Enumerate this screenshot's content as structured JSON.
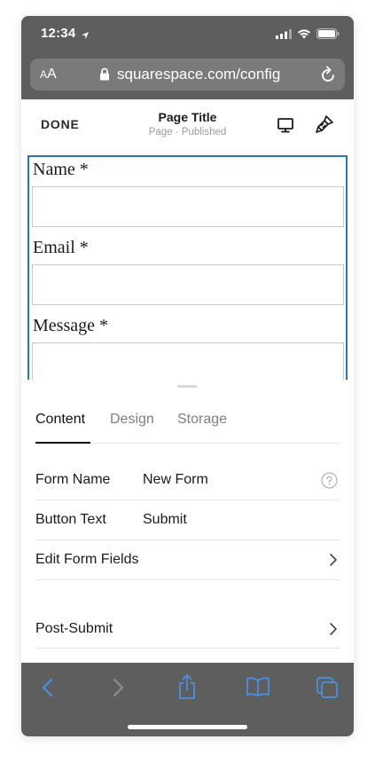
{
  "status_bar": {
    "time": "12:34"
  },
  "url_bar": {
    "aa_small": "A",
    "aa_large": "A",
    "url": "squarespace.com/config"
  },
  "editor_header": {
    "done_label": "DONE",
    "page_title": "Page Title",
    "page_subtitle": "Page · Published"
  },
  "form_preview": {
    "fields": [
      {
        "label": "Name *"
      },
      {
        "label": "Email *"
      },
      {
        "label": "Message *"
      }
    ]
  },
  "panel": {
    "tabs": [
      {
        "label": "Content",
        "active": true
      },
      {
        "label": "Design",
        "active": false
      },
      {
        "label": "Storage",
        "active": false
      }
    ],
    "rows": [
      {
        "label": "Form Name",
        "value": "New Form",
        "icon": "help-icon"
      },
      {
        "label": "Button Text",
        "value": "Submit"
      },
      {
        "label": "Edit Form Fields",
        "icon": "chevron-right-icon"
      },
      {
        "label": "Post-Submit",
        "icon": "chevron-right-icon"
      }
    ]
  },
  "toolbar": {
    "icons": [
      "back-icon",
      "forward-icon",
      "share-icon",
      "bookmarks-icon",
      "tabs-icon"
    ]
  },
  "colors": {
    "browser_chrome": "#5e5e5e",
    "toolbar_accent": "#4a90e2",
    "selection_border": "#2b74b8"
  }
}
